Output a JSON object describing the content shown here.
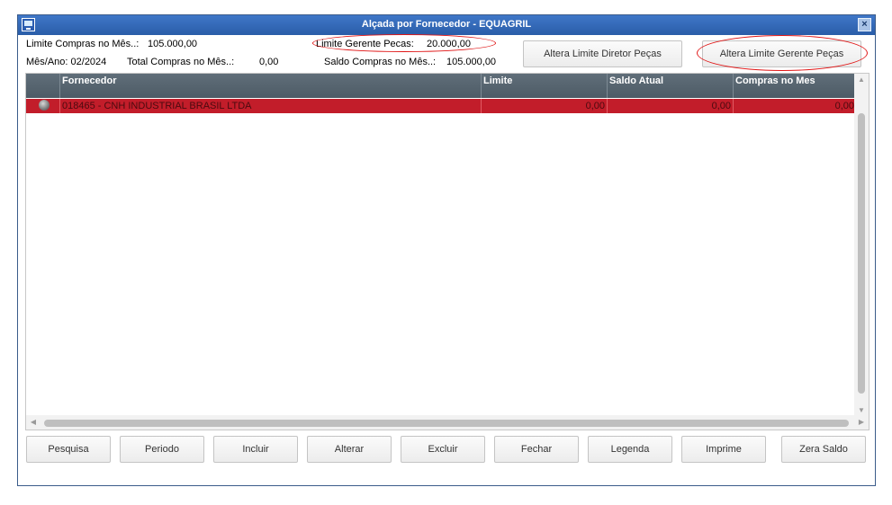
{
  "window": {
    "title": "Alçada por Fornecedor - EQUAGRIL"
  },
  "info": {
    "limite_compras_label": "Limite Compras no Mês..:",
    "limite_compras_value": "105.000,00",
    "mes_ano_label": "Mês/Ano: 02/2024",
    "total_compras_label": "Total Compras no Mês..:",
    "total_compras_value": "0,00",
    "limite_gerente_label": "Limite Gerente Pecas:",
    "limite_gerente_value": "20.000,00",
    "saldo_compras_label": "Saldo Compras no Mês..:",
    "saldo_compras_value": "105.000,00"
  },
  "buttons": {
    "altera_diretor": "Altera Limite Diretor Peças",
    "altera_gerente": "Altera Limite Gerente Peças"
  },
  "table": {
    "columns": [
      "Fornecedor",
      "Limite",
      "Saldo Atual",
      "Compras no Mes"
    ],
    "rows": [
      {
        "fornecedor": "018465 - CNH INDUSTRIAL BRASIL LTDA",
        "limite": "0,00",
        "saldo_atual": "0,00",
        "compras_mes": "0,00"
      }
    ]
  },
  "bottom_buttons": [
    "Pesquisa",
    "Periodo",
    "Incluir",
    "Alterar",
    "Excluir",
    "Fechar",
    "Legenda",
    "Imprime",
    "Zera Saldo"
  ],
  "colors": {
    "title_bar": "#2f66b8",
    "selected_row": "#c21d2a",
    "annotation": "#e01515",
    "header": "#56646f"
  }
}
